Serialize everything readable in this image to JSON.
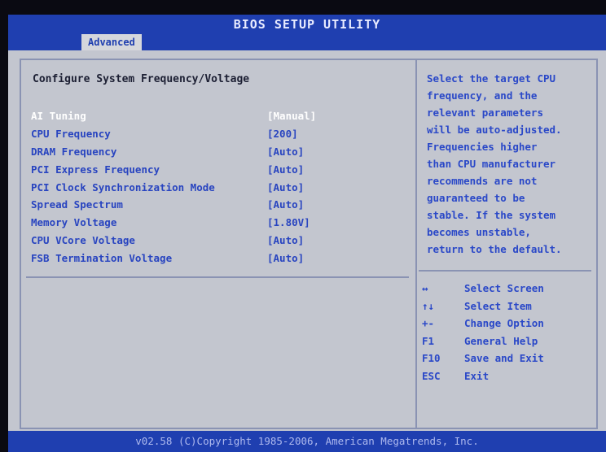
{
  "title": "BIOS SETUP UTILITY",
  "tab": "Advanced",
  "section_title": "Configure System Frequency/Voltage",
  "settings": [
    {
      "label": "AI Tuning",
      "value": "[Manual]"
    },
    {
      "label": "CPU Frequency",
      "value": "[200]"
    },
    {
      "label": "DRAM Frequency",
      "value": "[Auto]"
    },
    {
      "label": "PCI Express Frequency",
      "value": "[Auto]"
    },
    {
      "label": "PCI Clock Synchronization Mode",
      "value": "[Auto]"
    },
    {
      "label": "Spread Spectrum",
      "value": "[Auto]"
    },
    {
      "label": "Memory Voltage",
      "value": "[1.80V]"
    },
    {
      "label": "CPU VCore Voltage",
      "value": "[Auto]"
    },
    {
      "label": "FSB Termination Voltage",
      "value": "[Auto]"
    }
  ],
  "help_lines": [
    "Select the target CPU",
    "frequency, and the",
    "relevant parameters",
    "will be auto-adjusted.",
    "Frequencies higher",
    "than CPU manufacturer",
    "recommends are not",
    "guaranteed to be",
    "stable. If the system",
    "becomes unstable,",
    "return to the default."
  ],
  "keys": [
    {
      "key": "↔",
      "desc": "Select Screen"
    },
    {
      "key": "↑↓",
      "desc": "Select Item"
    },
    {
      "key": "+-",
      "desc": "Change Option"
    },
    {
      "key": "F1",
      "desc": "General Help"
    },
    {
      "key": "F10",
      "desc": "Save and Exit"
    },
    {
      "key": "ESC",
      "desc": "Exit"
    }
  ],
  "footer": "v02.58 (C)Copyright 1985-2006, American Megatrends, Inc.",
  "colors": {
    "accent": "#1f3fb0",
    "panel": "#c3c6cf",
    "text": "#2a48c8"
  }
}
